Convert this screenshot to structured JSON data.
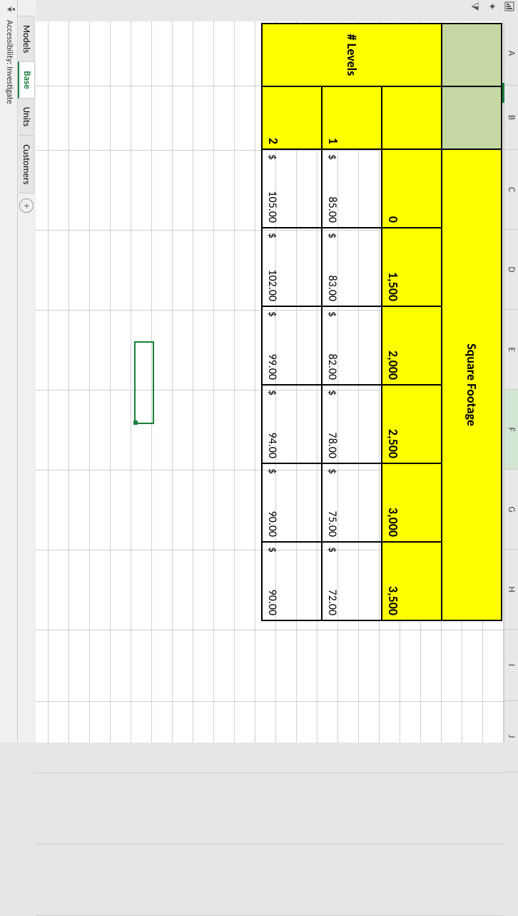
{
  "columns": [
    "A",
    "B",
    "C",
    "D",
    "E",
    "F",
    "G",
    "H",
    "I",
    "J"
  ],
  "active_column": "F",
  "table": {
    "merged_header": "Square Footage",
    "side_header": "# Levels",
    "sqft": [
      "0",
      "1,500",
      "2,000",
      "2,500",
      "3,000",
      "3,500"
    ],
    "rows": [
      {
        "level": "1",
        "values": [
          "85.00",
          "83.00",
          "82.00",
          "78.00",
          "75.00",
          "72.00"
        ]
      },
      {
        "level": "2",
        "values": [
          "105.00",
          "102.00",
          "99.00",
          "94.00",
          "90.00",
          "90.00"
        ]
      }
    ],
    "currency": "$"
  },
  "sheets": {
    "tabs": [
      "Models",
      "Base",
      "Units",
      "Customers"
    ],
    "active": "Base"
  },
  "status": {
    "accessibility": "Accessibility: Investigate"
  }
}
